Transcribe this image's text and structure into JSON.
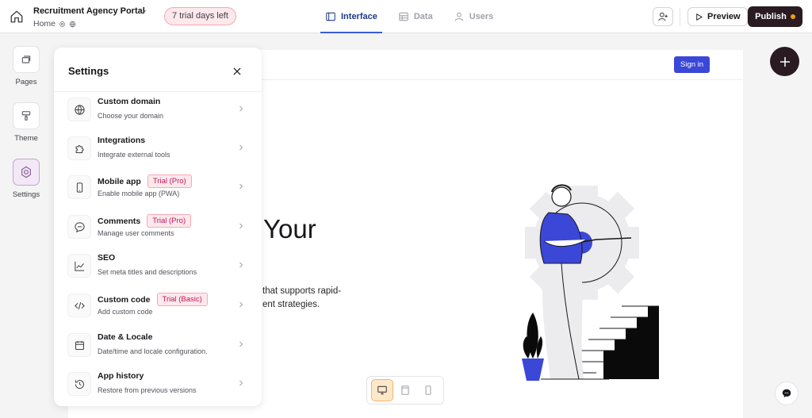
{
  "header": {
    "app_title": "Recruitment Agency Portal",
    "breadcrumb": "Home",
    "trial_text": "7 trial days left",
    "tabs": [
      {
        "label": "Interface",
        "active": true
      },
      {
        "label": "Data",
        "active": false
      },
      {
        "label": "Users",
        "active": false
      }
    ],
    "preview_label": "Preview",
    "publish_label": "Publish"
  },
  "rail": {
    "items": [
      {
        "label": "Pages",
        "icon": "pages-icon"
      },
      {
        "label": "Theme",
        "icon": "paint-roller-icon"
      },
      {
        "label": "Settings",
        "icon": "settings-icon",
        "active": true
      }
    ]
  },
  "settings": {
    "title": "Settings",
    "items": [
      {
        "title": "Custom domain",
        "desc": "Choose your domain",
        "badge": "",
        "icon": "globe-icon"
      },
      {
        "title": "Integrations",
        "desc": "Integrate external tools",
        "badge": "",
        "icon": "puzzle-icon"
      },
      {
        "title": "Mobile app",
        "desc": "Enable mobile app (PWA)",
        "badge": "Trial (Pro)",
        "icon": "phone-icon"
      },
      {
        "title": "Comments",
        "desc": "Manage user comments",
        "badge": "Trial (Pro)",
        "icon": "comment-icon"
      },
      {
        "title": "SEO",
        "desc": "Set meta titles and descriptions",
        "badge": "",
        "icon": "chart-line-icon"
      },
      {
        "title": "Custom code",
        "desc": "Add custom code",
        "badge": "Trial (Basic)",
        "icon": "code-icon"
      },
      {
        "title": "Date & Locale",
        "desc": "Date/time and locale configuration.",
        "badge": "",
        "icon": "calendar-icon"
      },
      {
        "title": "App history",
        "desc": "Restore from previous versions",
        "badge": "",
        "icon": "history-icon"
      }
    ]
  },
  "canvas": {
    "signin_label": "Sign in",
    "hero_word": "Your",
    "hero_line1": "that supports rapid-",
    "hero_line2": "ent strategies."
  },
  "colors": {
    "accent": "#3b5bdb",
    "publish_bg": "#2a1a22",
    "trial_bg": "#fde8ec",
    "signin_bg": "#3b47d6"
  }
}
